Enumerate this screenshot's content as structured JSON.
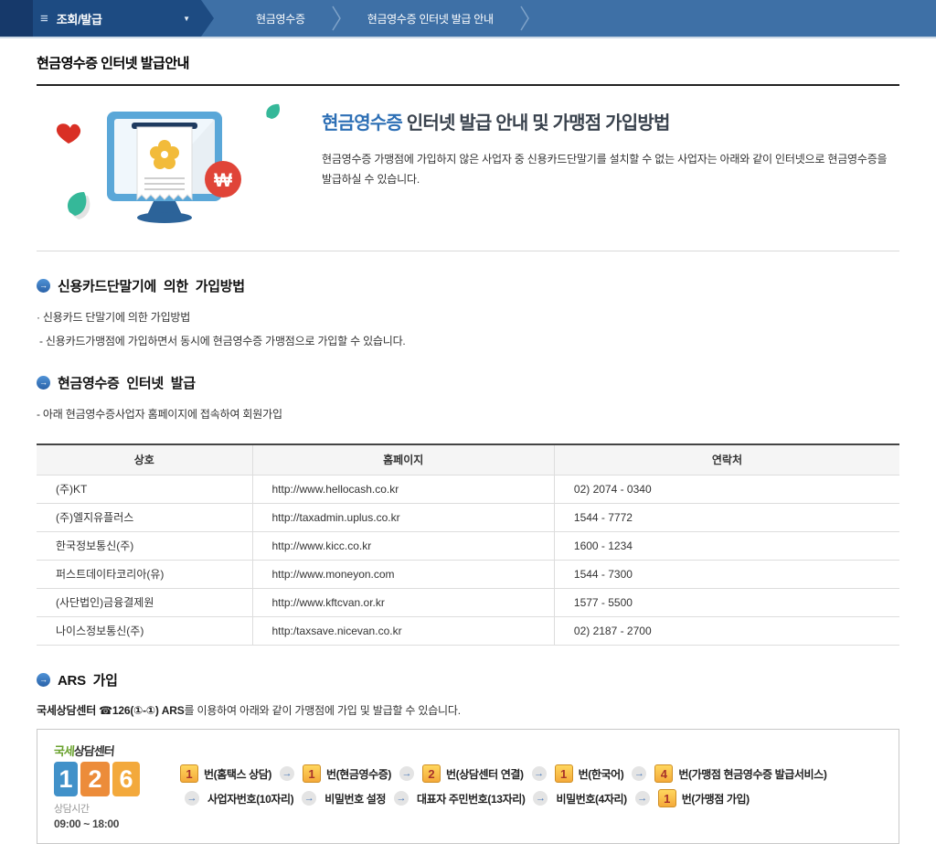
{
  "nav": {
    "hamburger_icon": "≡",
    "caret_icon": "▼",
    "menu_label": "조회/발급",
    "breadcrumbs": [
      "현금영수증",
      "현금영수증 인터넷 발급 안내"
    ]
  },
  "page": {
    "title": "현금영수증 인터넷 발급안내"
  },
  "hero": {
    "heading_highlight": "현금영수증",
    "heading_rest": " 인터넷 발급 안내 및 가맹점 가입방법",
    "description": "현금영수증 가맹점에 가입하지 않은 사업자 중 신용카드단말기를 설치할 수 없는 사업자는 아래와 같이 인터넷으로 현금영수증을 발급하실 수 있습니다."
  },
  "sections": {
    "icon_char": "→",
    "card_terminal": {
      "title": "신용카드단말기에 의한 가입방법",
      "line1": "· 신용카드 단말기에 의한 가입방법",
      "line2": "- 신용카드가맹점에 가입하면서 동시에 현금영수증 가맹점으로 가입할 수 있습니다."
    },
    "internet_issue": {
      "title": "현금영수증 인터넷 발급",
      "line1": "- 아래 현금영수증사업자 홈페이지에 접속하여 회원가입"
    },
    "ars": {
      "title": "ARS 가입",
      "intro_bold": "국세상담센터 ☎126(①-①) ARS",
      "intro_rest": "를 이용하여 아래와 같이 가맹점에 가입 및 발급할 수 있습니다."
    }
  },
  "table": {
    "headers": [
      "상호",
      "홈페이지",
      "연락처"
    ],
    "rows": [
      [
        "(주)KT",
        "http://www.hellocash.co.kr",
        "02) 2074 - 0340"
      ],
      [
        "(주)엘지유플러스",
        "http://taxadmin.uplus.co.kr",
        "1544 - 7772"
      ],
      [
        "한국정보통신(주)",
        "http://www.kicc.co.kr",
        "1600 - 1234"
      ],
      [
        "퍼스트데이타코리아(유)",
        "http://www.moneyon.com",
        "1544 - 7300"
      ],
      [
        "(사단법인)금융결제원",
        "http://www.kftcvan.or.kr",
        "1577 - 5500"
      ],
      [
        "나이스정보통신(주)",
        "http:/taxsave.nicevan.co.kr",
        "02) 2187 - 2700"
      ]
    ]
  },
  "ars_box": {
    "arrow_icon": "→",
    "logo": {
      "top_green": "국세",
      "top_dark": "상담센터",
      "digits": [
        "1",
        "2",
        "6"
      ],
      "hours_label": "상담시간",
      "hours_value": "09:00 ~ 18:00"
    },
    "steps_line1": [
      {
        "badge": "1",
        "label": "번(홈택스 상담)"
      },
      {
        "badge": "1",
        "label": "번(현금영수증)"
      },
      {
        "badge": "2",
        "label": "번(상담센터 연결)"
      },
      {
        "badge": "1",
        "label": "번(한국어)"
      },
      {
        "badge": "4",
        "label": "번(가맹점 현금영수증 발급서비스)"
      }
    ],
    "steps_line2": [
      {
        "label": "사업자번호(10자리)"
      },
      {
        "label": "비밀번호 설정"
      },
      {
        "label": "대표자 주민번호(13자리)"
      },
      {
        "label": "비밀번호(4자리)"
      },
      {
        "badge": "1",
        "label": "번(가맹점 가입)"
      }
    ]
  },
  "colors": {
    "nav_dark": "#16396a",
    "nav_dropdown": "#1d4b82",
    "nav_breadcrumb": "#3e70a6",
    "accent_blue": "#2d6fb5",
    "badge_bg": "#f4a93a",
    "badge_text": "#a8322a",
    "won_red": "#e04438",
    "leaf_teal": "#35b899"
  }
}
